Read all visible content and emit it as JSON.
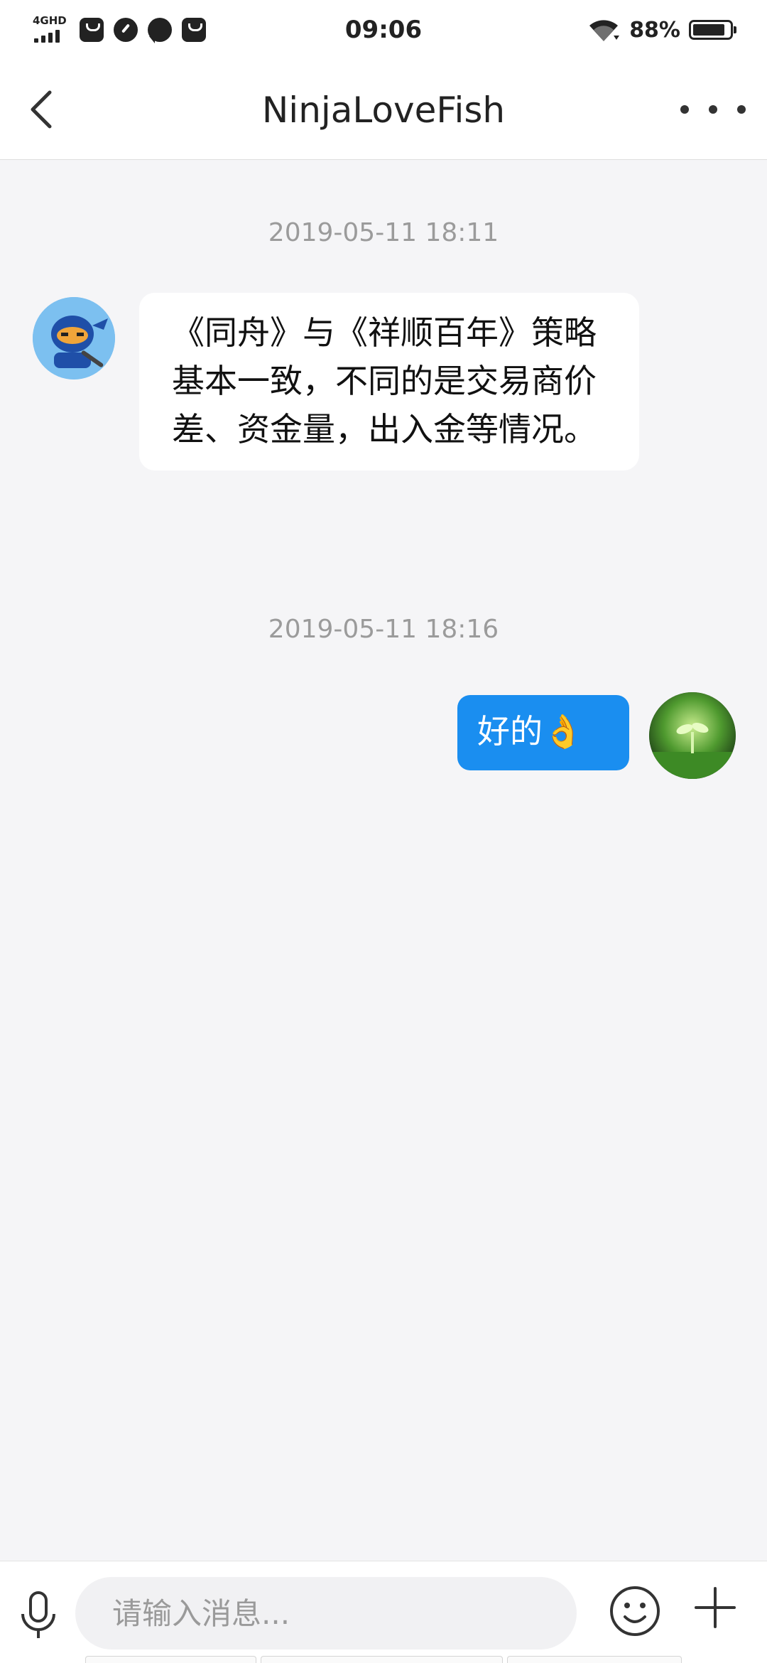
{
  "status_bar": {
    "network": "4GHD",
    "time": "09:06",
    "battery_percent": "88%",
    "battery_level": 0.88,
    "notification_icons": [
      "shopping-bag-icon",
      "gauge-icon",
      "chat-bubble-icon",
      "shopping-bag-icon"
    ]
  },
  "header": {
    "title": "NinjaLoveFish",
    "back_icon": "chevron-left-icon",
    "more_icon": "more-dots-icon"
  },
  "messages": [
    {
      "timestamp": "2019-05-11 18:11",
      "direction": "incoming",
      "avatar": "ninja-avatar",
      "text": "《同舟》与《祥顺百年》策略基本一致，不同的是交易商价差、资金量，出入金等情况。"
    },
    {
      "timestamp": "2019-05-11 18:16",
      "direction": "outgoing",
      "avatar": "plant-sprout-avatar",
      "text": "好的👌"
    }
  ],
  "input_bar": {
    "placeholder": "请输入消息...",
    "value": "",
    "icons": [
      "microphone-icon",
      "emoji-icon",
      "plus-icon"
    ]
  },
  "colors": {
    "background": "#f5f5f7",
    "outgoing_bubble": "#1a8ef0",
    "incoming_bubble": "#ffffff",
    "timestamp": "#9b9b9b"
  }
}
